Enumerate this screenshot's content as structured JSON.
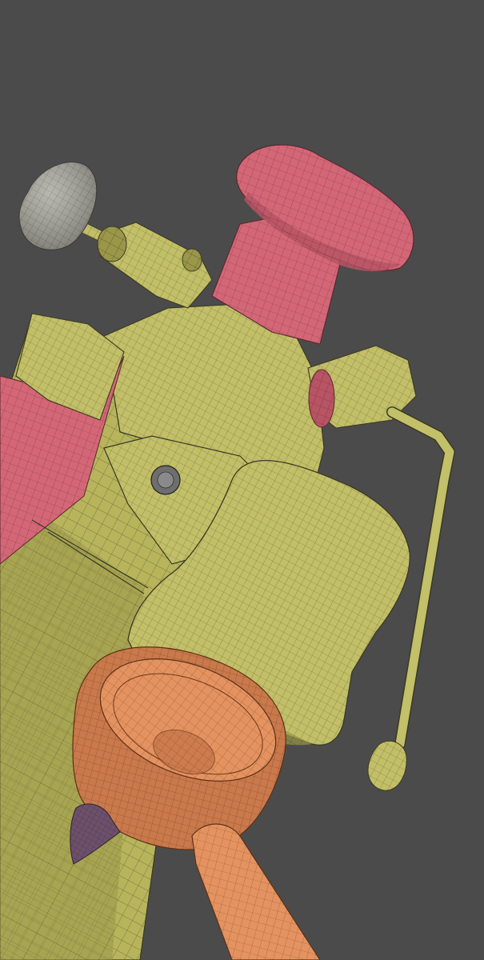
{
  "viewport": {
    "background": "#4b4b4b",
    "description_hidden": ""
  },
  "colors": {
    "body": "#b9b65e",
    "body_dark": "#8f8c45",
    "body_light": "#cfcc78",
    "wire": "#3b3a22",
    "pink": "#d86a7a",
    "pink_dark": "#b24f5e",
    "orange": "#e59463",
    "orange_dark": "#c06f45",
    "grey_knob": "#a8a89e",
    "purple": "#6a4f6a"
  },
  "parts": [
    {
      "id": "main-body",
      "material": "body"
    },
    {
      "id": "pink-knob",
      "material": "pink"
    },
    {
      "id": "grey-valve-knob",
      "material": "grey_knob"
    },
    {
      "id": "steam-wand",
      "material": "body"
    },
    {
      "id": "group-head",
      "material": "body"
    },
    {
      "id": "portafilter",
      "material": "orange"
    },
    {
      "id": "side-panel",
      "material": "pink"
    },
    {
      "id": "lever-tip",
      "material": "purple"
    }
  ]
}
